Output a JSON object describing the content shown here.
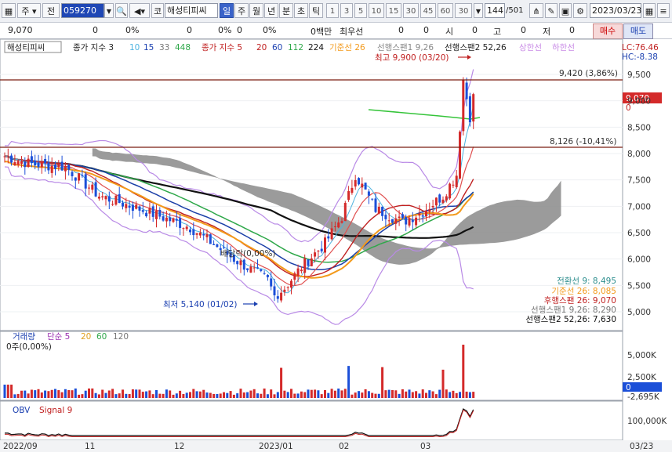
{
  "toolbar": {
    "items": [
      "주",
      "전",
      "코",
      "일",
      "주",
      "월",
      "년",
      "분",
      "초",
      "틱"
    ],
    "code": "059270",
    "name": "해성티피씨",
    "periods": [
      "1",
      "3",
      "5",
      "10",
      "15",
      "30",
      "45",
      "60"
    ],
    "interval": "30",
    "bars": "144",
    "total": "/501",
    "date": "2023/03/23"
  },
  "quote": {
    "price": "9,070",
    "v1": "0",
    "p1": "0%",
    "v2": "0",
    "p2": "0%",
    "v3": "0",
    "p3": "0%",
    "amount": "0백만",
    "best": "최우선",
    "v4": "0",
    "v5": "0",
    "si": "시",
    "v6": "0",
    "go": "고",
    "v7": "0",
    "jeo": "저",
    "v8": "0",
    "buy": "매수",
    "sell": "매도"
  },
  "legend": {
    "name": "해성티피씨",
    "ma_label": "종가 지수 3",
    "ma_vals": [
      "10",
      "15",
      "33",
      "448"
    ],
    "ma2_label": "종가 지수 5",
    "ma2_vals": [
      "20",
      "60",
      "112",
      "224"
    ],
    "base": "기준선 26",
    "span1": "선행스팬1 9,26",
    "span2": "선행스팬2 52,26",
    "limit_up": "상한선",
    "limit_down": "하한선",
    "lc": "LC:76.46",
    "hc": "HC:-8.38"
  },
  "annotations": {
    "high": "최고 9,900 (03/20)",
    "low": "최저 5,140 (01/02)",
    "line1": "9,420 (3,86%)",
    "line2": "8,126 (-10,41%)",
    "ex": "배당락(0,00%)",
    "price_tag": "9,070",
    "zero": "0"
  },
  "ichimoku": {
    "conv": "전환선 9: 8,495",
    "base": "기준선 26: 8,085",
    "lag": "후행스팬 26: 9,070",
    "s1": "선행스팬1 9,26: 8,290",
    "s2": "선행스팬2 52,26: 7,630"
  },
  "price_axis": [
    "9,500",
    "9,000",
    "8,500",
    "8,000",
    "7,500",
    "7,000",
    "6,500",
    "6,000",
    "5,500",
    "5,000"
  ],
  "volume": {
    "label": "거래량",
    "ma_label": "단순 5",
    "ma_vals": [
      "20",
      "60",
      "120"
    ],
    "now": "0주(0,00%)",
    "axis": [
      "5,000K",
      "2,500K",
      "-2,695K"
    ],
    "tag": "0"
  },
  "obv": {
    "label": "OBV",
    "signal": "Signal 9",
    "axis": "100,000K"
  },
  "date_axis": [
    "2022/09",
    "11",
    "12",
    "2023/01",
    "02",
    "03",
    "03/23"
  ],
  "colors": {
    "up": "#d42a2a",
    "down": "#1b4fd8",
    "ma_black": "#111111",
    "ma_green": "#2fa84a",
    "ma_orange": "#f39a1b",
    "band": "#b98ae6"
  }
}
